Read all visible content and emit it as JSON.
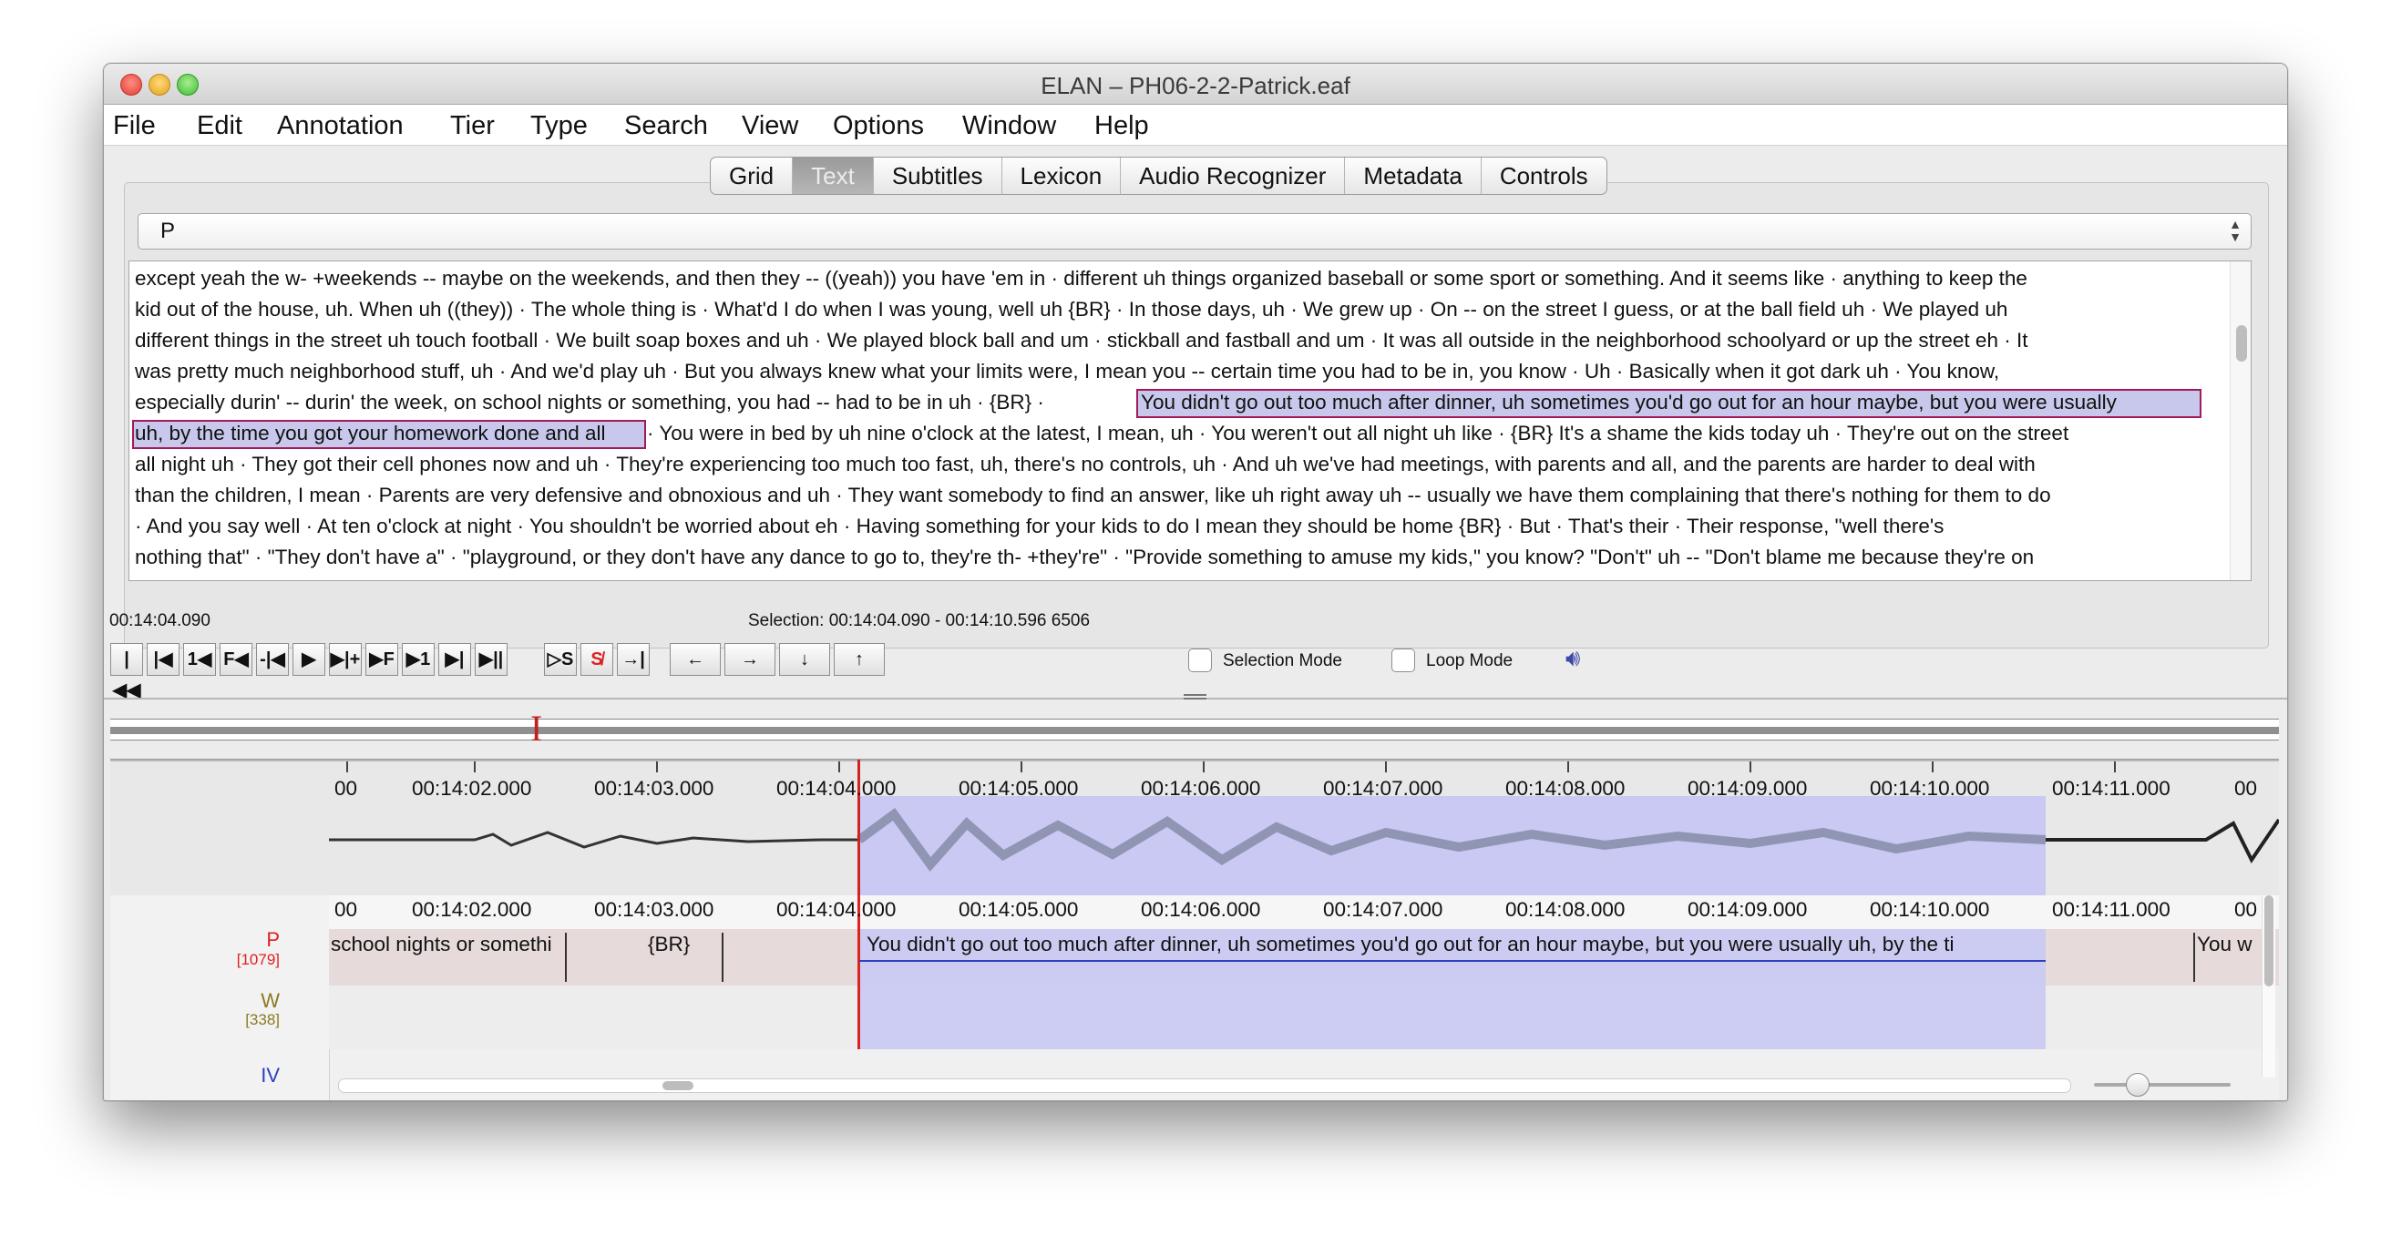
{
  "window": {
    "title": "ELAN – PH06-2-2-Patrick.eaf"
  },
  "menu": [
    "File",
    "Edit",
    "Annotation",
    "Tier",
    "Type",
    "Search",
    "View",
    "Options",
    "Window",
    "Help"
  ],
  "tabs": [
    "Grid",
    "Text",
    "Subtitles",
    "Lexicon",
    "Audio Recognizer",
    "Metadata",
    "Controls"
  ],
  "active_tab": "Text",
  "tier_select": "P",
  "text_lines": [
    "except yeah the w- +weekends -- maybe on the weekends, and then they -- ((yeah)) you have 'em in  ·  different uh things organized baseball or some sport or something.  And it seems like  ·  anything to keep the",
    "kid out of the house, uh.  When uh ((they))  ·  The whole thing is  ·  What'd I do when I was young, well uh {BR}  ·  In those days, uh  ·  We grew up  ·  On -- on the street I guess, or at the ball field uh  ·  We played uh",
    "different things in the street uh touch football  ·  We built soap boxes and uh  ·  We played block ball and um  ·  stickball and fastball and um  ·  It was all outside in the neighborhood schoolyard or up the street eh  ·  It",
    "was pretty much neighborhood stuff, uh  ·  And we'd play uh  ·  But you always knew what your limits were, I mean you -- certain time you had to be in, you know  ·  Uh  ·  Basically when it got dark uh  ·  You know,",
    "especially durin' -- durin' the week, on school nights or something, you had -- had to be in uh  ·  {BR}  ·  ",
    "You didn't go out too much after dinner, uh sometimes you'd go out for an hour maybe, but you were usually",
    "uh, by the time you got your homework done and all",
    "  ·  You were in bed by uh nine o'clock at the latest, I mean, uh  ·  You weren't out all night uh like  ·  {BR} It's a shame the kids today uh  ·  They're out on the street",
    "all night uh  ·  They got their cell phones now and uh  ·  They're experiencing too much too fast, uh, there's no controls, uh  ·  And uh we've had meetings, with parents and all, and the parents are harder to deal with",
    "than the children, I mean  ·  Parents are very defensive and obnoxious and uh  ·  They want somebody to find an answer, like uh right away uh -- usually we have them complaining that there's nothing for them to do",
    "·  And you say well  ·  At ten o'clock at night   ·  You shouldn't be worried about eh  ·  Having something for your kids to do I mean they should be home {BR}  ·  But  ·  That's their  ·  Their response, \"well there's",
    "nothing that\"  ·  \"They don't have a\"  ·  \"playground, or they don't have any dance to go to, they're th- +they're\"  ·  \"Provide something to amuse my kids,\" you know? \"Don't\" uh -- \"Don't blame me because they're on"
  ],
  "current_time": "00:14:04.090",
  "selection": "Selection: 00:14:04.090 - 00:14:10.596  6506",
  "controls": [
    "|◀◀",
    "|◀",
    "1◀",
    "F◀",
    "-|◀",
    "▶",
    "▶|+",
    "▶F",
    "▶1",
    "▶|",
    "▶||",
    "▷S",
    "S̸",
    "→|",
    "←",
    "→",
    "↓",
    "↑"
  ],
  "checkboxes": {
    "selection_mode": "Selection Mode",
    "loop_mode": "Loop Mode"
  },
  "ruler_labels": [
    "00",
    "00:14:02.000",
    "00:14:03.000",
    "00:14:04.000",
    "00:14:05.000",
    "00:14:06.000",
    "00:14:07.000",
    "00:14:08.000",
    "00:14:09.000",
    "00:14:10.000",
    "00:14:11.000",
    "00"
  ],
  "tiers": [
    {
      "name": "P",
      "count": "[1079]",
      "color": "#e02020"
    },
    {
      "name": "W",
      "count": "[338]",
      "color": "#8a7a20"
    },
    {
      "name": "IV",
      "count": "",
      "color": "#2b3fbf"
    }
  ],
  "annotations": [
    "school nights or somethi",
    "{BR}",
    "You didn't go out too much after dinner, uh sometimes you'd go out for an hour maybe, but you were usually uh, by the ti",
    "You w"
  ],
  "colors": {
    "selection": "#c9c9f4",
    "cursor": "#d22222",
    "highlight_border": "#a4195a"
  }
}
